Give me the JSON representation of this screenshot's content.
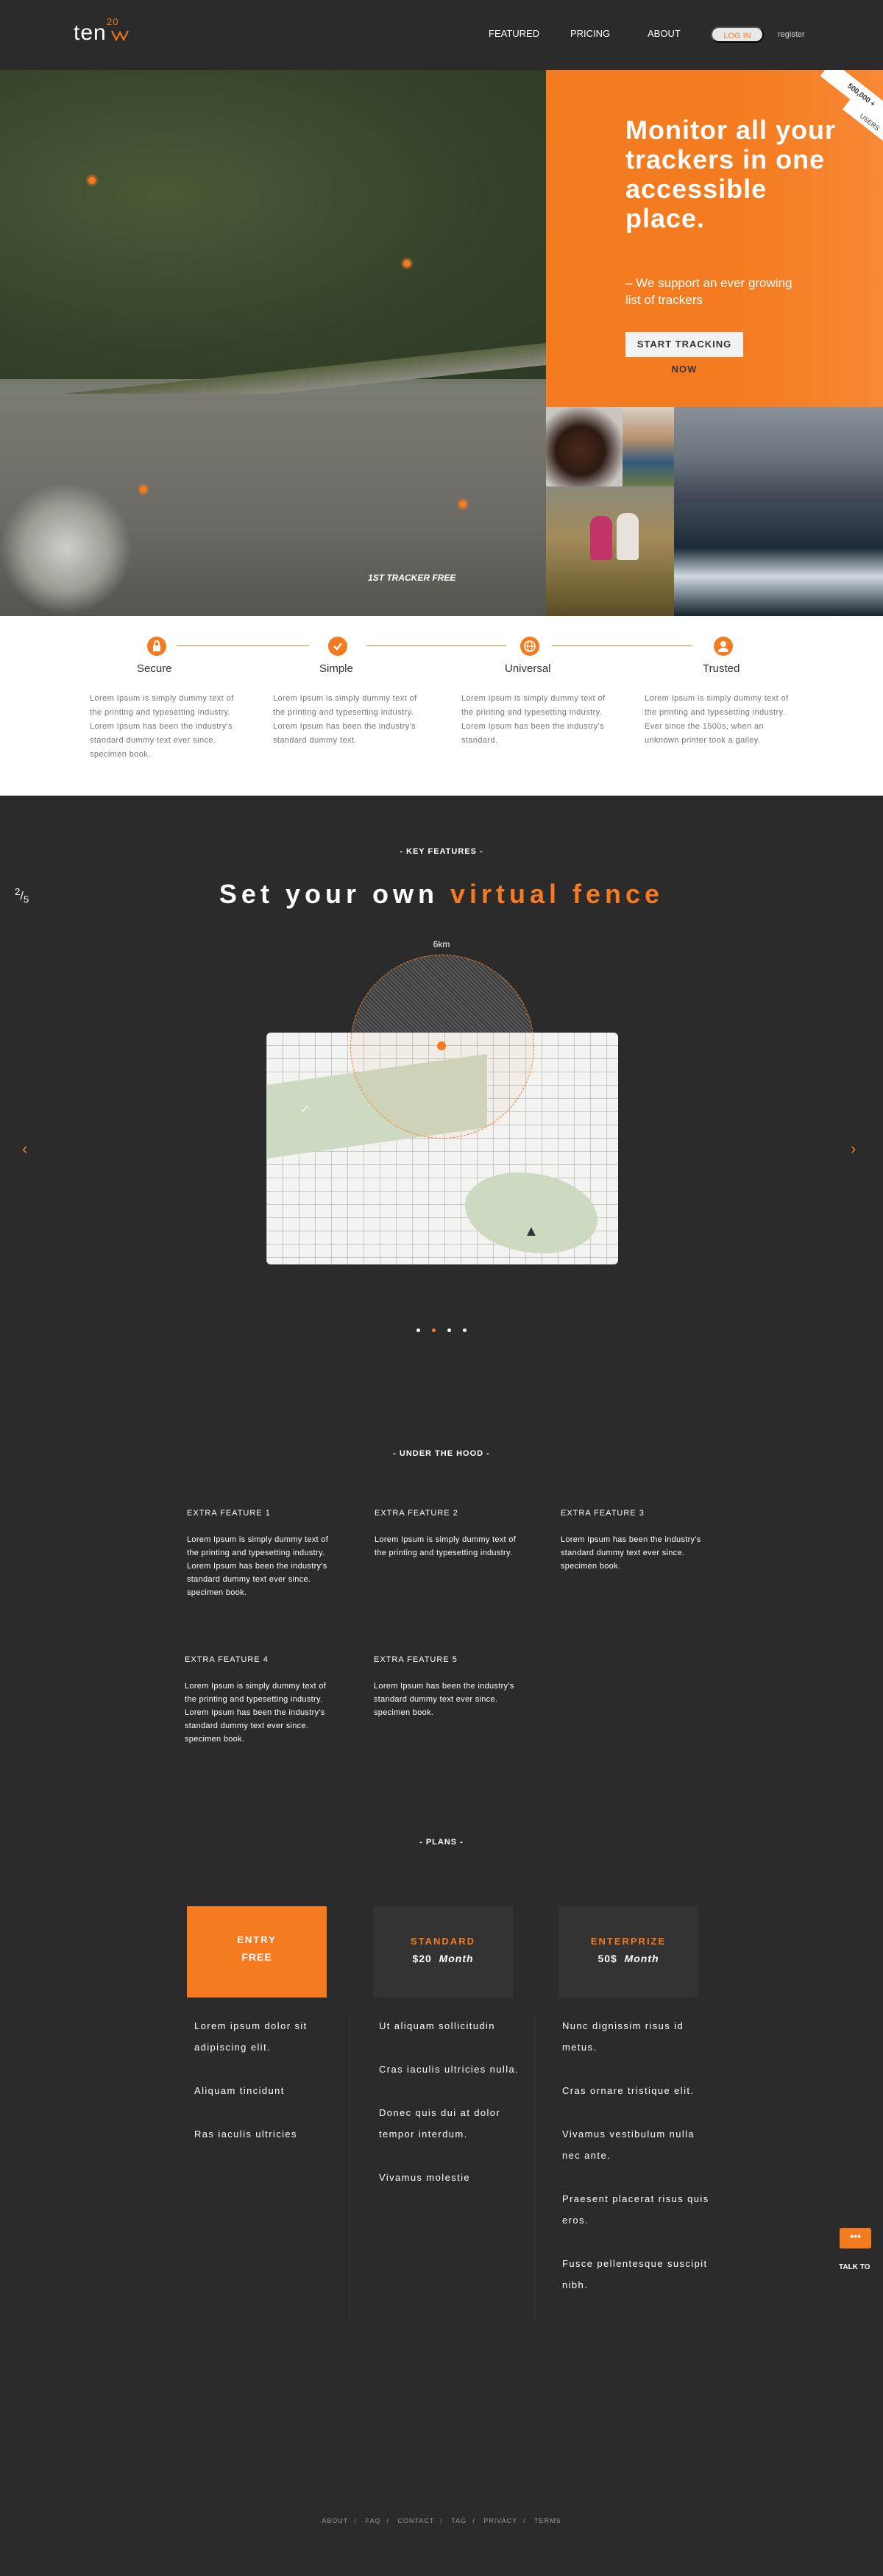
{
  "header": {
    "logo_text": "ten",
    "logo_superscript": "20",
    "nav": [
      "FEATURED",
      "PRICING",
      "ABOUT"
    ],
    "login": "LOG IN",
    "register": "register"
  },
  "hero": {
    "title": "Monitor all your trackers in one accessible place.",
    "subtitle": "– We support an ever growing list of trackers",
    "cta": "START TRACKING NOW",
    "ribbon_count": "500,000 +",
    "ribbon_users": "USERS",
    "map_caption": "1ST TRACKER FREE"
  },
  "features": [
    {
      "icon": "lock-icon",
      "title": "Secure",
      "text": "Lorem Ipsum is simply dummy text of the printing and typesetting industry. Lorem Ipsum has been the industry's standard dummy text ever since. specimen book."
    },
    {
      "icon": "check-icon",
      "title": "Simple",
      "text": "Lorem Ipsum is simply dummy text of the printing and typesetting industry. Lorem Ipsum has been the industry's standard dummy text."
    },
    {
      "icon": "globe-icon",
      "title": "Universal",
      "text": "Lorem Ipsum is simply dummy text of the printing and typesetting industry. Lorem Ipsum has been the industry's standard."
    },
    {
      "icon": "user-icon",
      "title": "Trusted",
      "text": "Lorem Ipsum is simply dummy text of the printing and typesetting industry. Ever since the 1500s, when an unknown printer took a galley."
    }
  ],
  "key_features": {
    "label": "- KEY FEATURES -",
    "slide_current": "2",
    "slide_total": "5",
    "title_plain": "Set your own",
    "title_accent": "virtual fence",
    "radius_label": "6km",
    "slides": 4,
    "active_slide": 1
  },
  "under_the_hood": {
    "label": "- UNDER THE HOOD -",
    "items": [
      {
        "title": "EXTRA FEATURE 1",
        "text": "Lorem Ipsum is simply dummy text of the printing and typesetting industry. Lorem Ipsum has been the industry's standard dummy text ever since. specimen book."
      },
      {
        "title": "EXTRA FEATURE 2",
        "text": "Lorem Ipsum is simply dummy text of the printing and typesetting industry."
      },
      {
        "title": "EXTRA FEATURE 3",
        "text": "Lorem Ipsum has been the industry's standard dummy text ever since. specimen book."
      },
      {
        "title": "EXTRA FEATURE 4",
        "text": "Lorem Ipsum is simply dummy text of the printing and typesetting industry. Lorem Ipsum has been the industry's standard dummy text ever since. specimen book."
      },
      {
        "title": "EXTRA FEATURE 5",
        "text": "Lorem Ipsum has been the industry's standard dummy text ever since. specimen book."
      }
    ]
  },
  "plans": {
    "label": "- PLANS -",
    "cards": [
      {
        "name": "ENTRY",
        "price": "FREE",
        "period": ""
      },
      {
        "name": "STANDARD",
        "price": "$20",
        "period": "Month"
      },
      {
        "name": "ENTERPRIZE",
        "price": "50$",
        "period": "Month"
      }
    ],
    "items": [
      [
        "Lorem ipsum dolor sit adipiscing elit.",
        "Aliquam tincidunt",
        "Ras iaculis ultricies"
      ],
      [
        "Ut aliquam sollicitudin",
        "Cras iaculis ultricies nulla.",
        "Donec quis dui at dolor tempor interdum.",
        "Vivamus molestie"
      ],
      [
        "Nunc dignissim risus id metus.",
        "Cras ornare tristique elit.",
        "Vivamus vestibulum nulla nec ante.",
        "Praesent placerat risus quis eros.",
        "Fusce pellentesque suscipit nibh."
      ]
    ]
  },
  "chat": {
    "label": "TALK TO",
    "icon": "chat-icon"
  },
  "footer": {
    "links": [
      "ABOUT",
      "FAQ",
      "CONTACT",
      "TAG",
      "PRIVACY",
      "TERMS"
    ]
  },
  "colors": {
    "accent": "#f47b20",
    "background": "#2b2b2b",
    "features_bg": "#ffffff"
  }
}
